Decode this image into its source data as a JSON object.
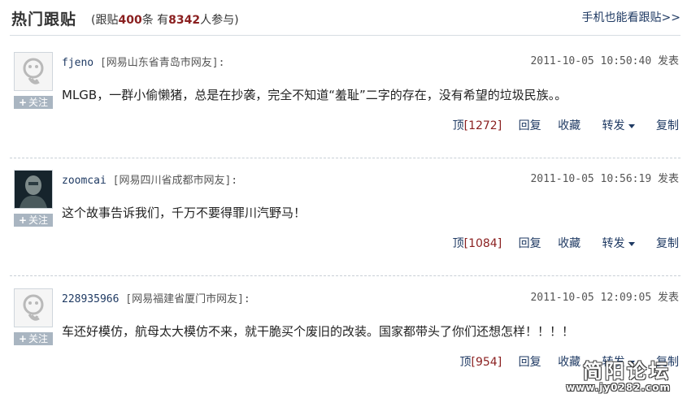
{
  "header": {
    "title": "热门跟贴",
    "stats_prefix": "(跟贴",
    "reply_count": "400",
    "stats_mid": "条 有",
    "participant_count": "8342",
    "stats_suffix": "人参与)",
    "mobile_link": "手机也能看跟贴>>"
  },
  "posts": [
    {
      "user": "fjeno",
      "location": "[网易山东省青岛市网友]:",
      "time": "2011-10-05 10:50:40 发表",
      "content": "MLGB，一群小偷懒猪，总是在抄袭，完全不知道“羞耻”二字的存在，没有希望的垃圾民族。。",
      "follow": "关注",
      "up_label": "顶",
      "up_count": "[1272]",
      "reply": "回复",
      "collect": "收藏",
      "forward": "转发",
      "copy": "复制",
      "avatar": "default-avatar-icon"
    },
    {
      "user": "zoomcai",
      "location": "[网易四川省成都市网友]:",
      "time": "2011-10-05 10:56:19 发表",
      "content": "这个故事告诉我们，千万不要得罪川汽野马！",
      "follow": "关注",
      "up_label": "顶",
      "up_count": "[1084]",
      "reply": "回复",
      "collect": "收藏",
      "forward": "转发",
      "copy": "复制",
      "avatar": "user-photo-avatar"
    },
    {
      "user": "228935966",
      "location": "[网易福建省厦门市网友]:",
      "time": "2011-10-05 12:09:05 发表",
      "content": "车还好模仿，航母太大模仿不来，就干脆买个废旧的改装。国家都带头了你们还想怎样！！！！",
      "follow": "关注",
      "up_label": "顶",
      "up_count": "[954]",
      "reply": "回复",
      "collect": "收藏",
      "forward": "转发",
      "copy": "复制",
      "avatar": "default-avatar-icon"
    }
  ],
  "watermark": {
    "text": "简阳论坛",
    "url": "www.jy0282.com"
  }
}
